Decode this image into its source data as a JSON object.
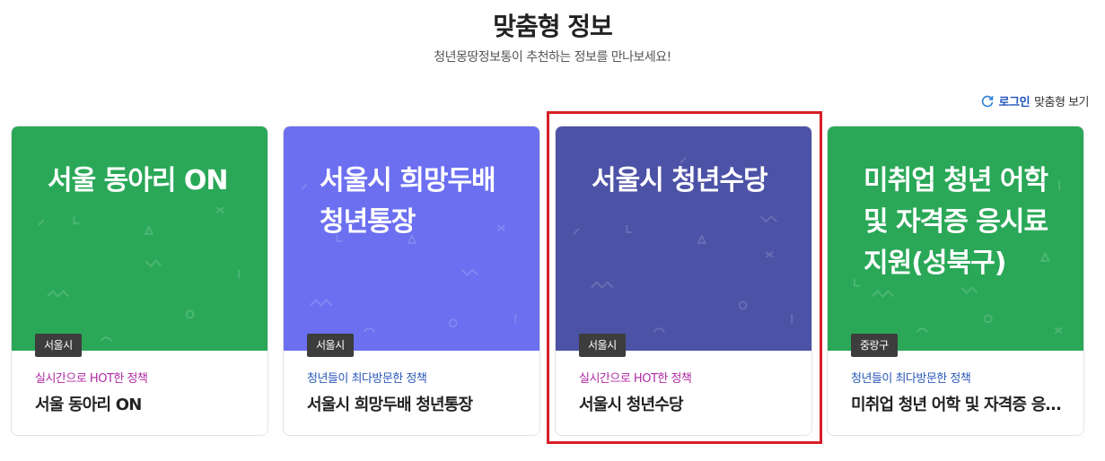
{
  "section": {
    "title": "맞춤형 정보",
    "subtitle": "청년몽땅정보통이 추천하는 정보를 만나보세요!"
  },
  "login_link": {
    "strong": "로그인",
    "text": "맞춤형 보기",
    "icon": "refresh-icon"
  },
  "colors": {
    "green": "#2aa858",
    "periwinkle": "#6b6ff0",
    "indigo": "#4c52a6",
    "highlight": "#d61f26"
  },
  "cards": [
    {
      "visual_title": "서울 동아리 ON",
      "tag": "서울시",
      "category": "실시간으로 HOT한 정책",
      "category_type": "hot",
      "name": "서울 동아리 ON",
      "color": "#2aa858"
    },
    {
      "visual_title": "서울시 희망두배 청년통장",
      "tag": "서울시",
      "category": "청년들이 최다방문한 정책",
      "category_type": "visit",
      "name": "서울시 희망두배 청년통장",
      "color": "#6b6ff0"
    },
    {
      "visual_title": "서울시 청년수당",
      "tag": "서울시",
      "category": "실시간으로 HOT한 정책",
      "category_type": "hot",
      "name": "서울시 청년수당",
      "color": "#4c52a6"
    },
    {
      "visual_title": "미취업 청년 어학 및 자격증 응시료 지원(성북구)",
      "tag": "중랑구",
      "category": "청년들이 최다방문한 정책",
      "category_type": "visit",
      "name": "미취업 청년 어학 및 자격증 응시료 지원(성북구)",
      "color": "#2aa858"
    }
  ]
}
